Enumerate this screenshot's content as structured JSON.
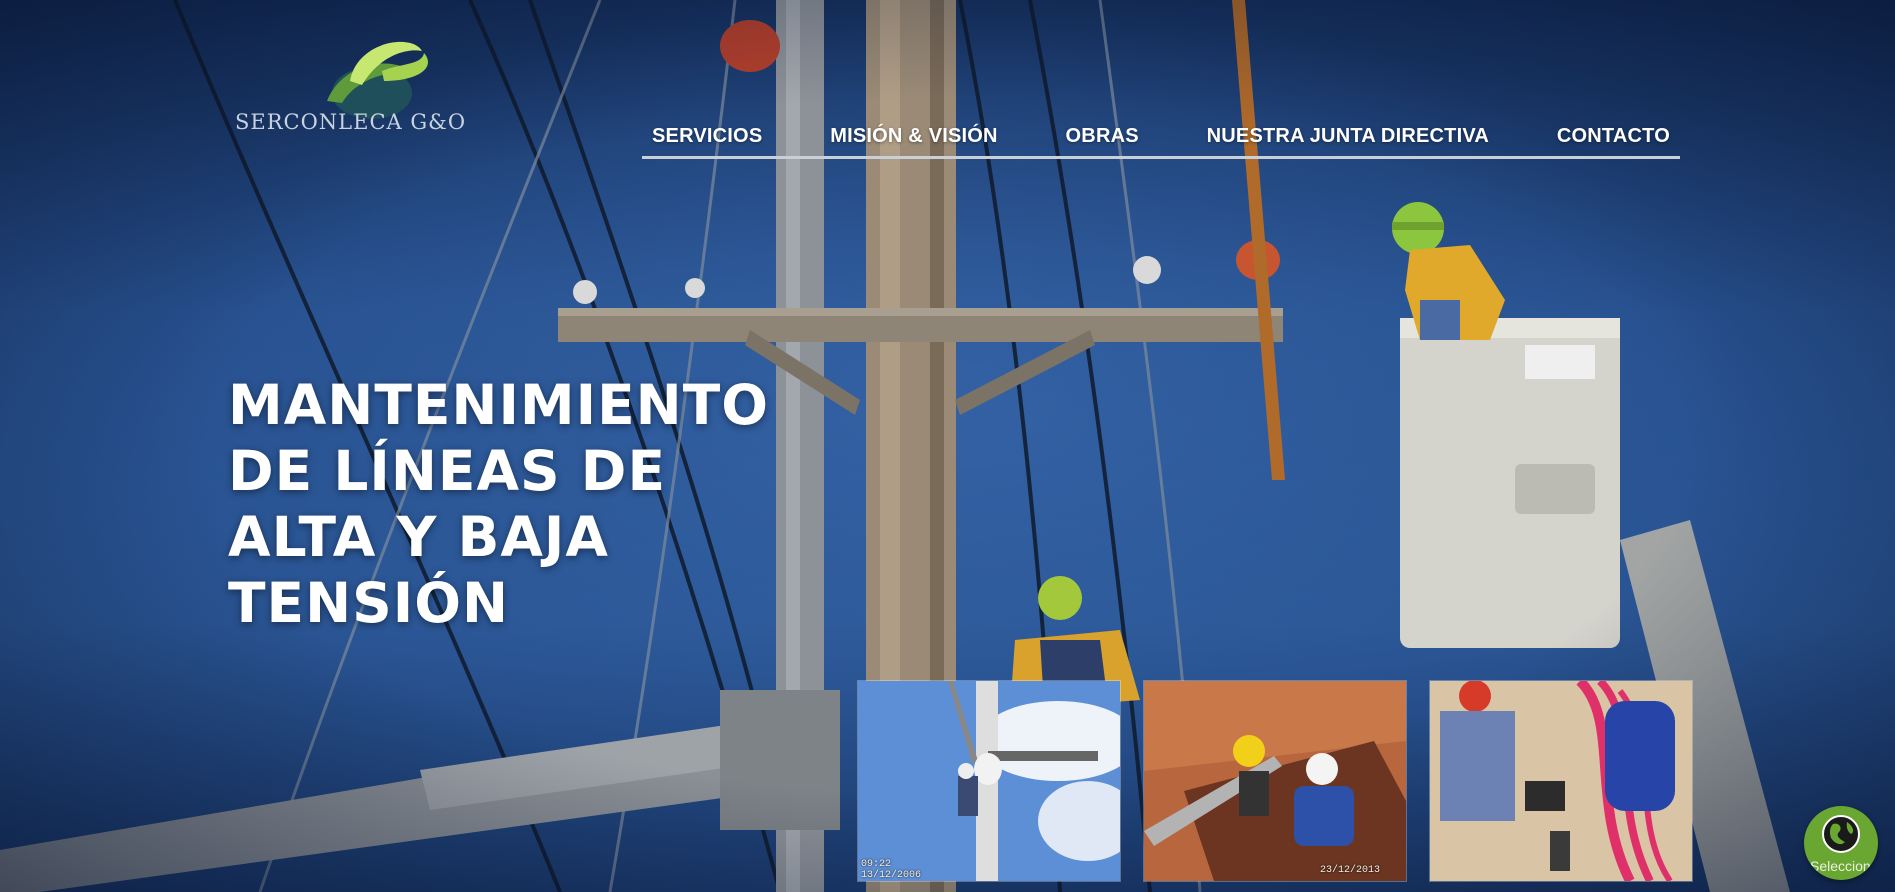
{
  "brand": {
    "name": "SERCONLECA G&O",
    "colors": {
      "leaf": "#c6e870",
      "swoosh_green": "#5f9b3a",
      "swoosh_teal": "#1f4f5a"
    }
  },
  "nav": {
    "items": [
      {
        "label": "SERVICIOS"
      },
      {
        "label": "MISIÓN & VISIÓN"
      },
      {
        "label": "OBRAS"
      },
      {
        "label": "NUESTRA JUNTA DIRECTIVA"
      },
      {
        "label": "CONTACTO"
      }
    ]
  },
  "hero": {
    "headline_lines": [
      "MANTENIMIENTO",
      "DE LÍNEAS DE",
      "ALTA Y BAJA",
      "TENSIÓN"
    ]
  },
  "gallery": [
    {
      "icon": "photo-lineman-on-pole",
      "stamp_time": "09:22",
      "stamp_date": "13/12/2006"
    },
    {
      "icon": "photo-workers-in-trench",
      "stamp_date": "23/12/2013"
    },
    {
      "icon": "photo-cable-testing"
    }
  ],
  "language_widget": {
    "label": "Selecciona",
    "icon": "globe-icon",
    "color": "#6aa632"
  }
}
